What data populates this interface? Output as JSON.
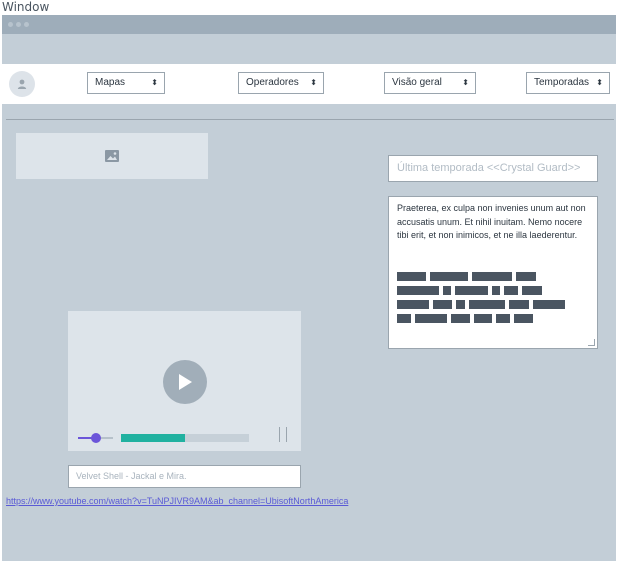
{
  "window": {
    "title": "Window"
  },
  "navbar": {
    "selects": [
      {
        "label": "Mapas"
      },
      {
        "label": "Operadores"
      },
      {
        "label": "Visão geral"
      },
      {
        "label": "Temporadas"
      }
    ]
  },
  "main": {
    "season_input": {
      "placeholder": "Última temporada <<Crystal Guard>>"
    },
    "description": "Praeterea, ex culpa non invenies unum aut non accusatis unum. Et nihil inuitam. Nemo nocere tibi erit, et non inimicos, et ne illa laederentur.",
    "video": {
      "progress_percent": 50,
      "volume_percent": 50
    },
    "video_caption": {
      "placeholder": "Velvet Shell - Jackal e Mira."
    },
    "link": "https://www.youtube.com/watch?v=TuNPJIVR9AM&ab_channel=UbisoftNorthAmerica"
  },
  "colors": {
    "accent_purple": "#6b55d9",
    "progress_teal": "#20b1a0",
    "panel_bg": "#c3ced7"
  },
  "icons": [
    "avatar-icon",
    "image-icon",
    "play-icon",
    "fullscreen-icon"
  ]
}
